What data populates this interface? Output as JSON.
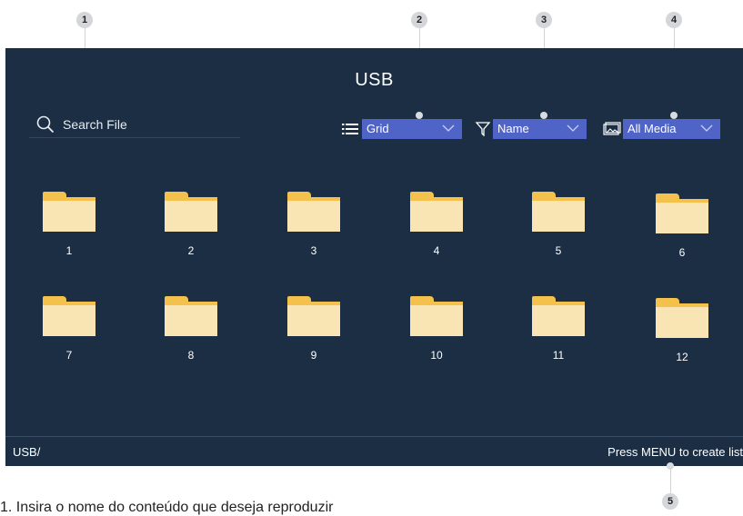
{
  "screen": {
    "title": "USB",
    "search_label": "Search File",
    "view_mode": "Grid",
    "sort_by": "Name",
    "media_filter": "All Media",
    "path": "USB/",
    "hint": "Press MENU to create list"
  },
  "folders": [
    "1",
    "2",
    "3",
    "4",
    "5",
    "6",
    "7",
    "8",
    "9",
    "10",
    "11",
    "12"
  ],
  "callouts": [
    "1",
    "2",
    "3",
    "4",
    "5"
  ],
  "caption": "1. Insira o nome do conteúdo que deseja reproduzir",
  "colors": {
    "screen_bg": "#1b2e44",
    "dropdown_bg": "#5064c8",
    "folder": "#f4c24c"
  }
}
